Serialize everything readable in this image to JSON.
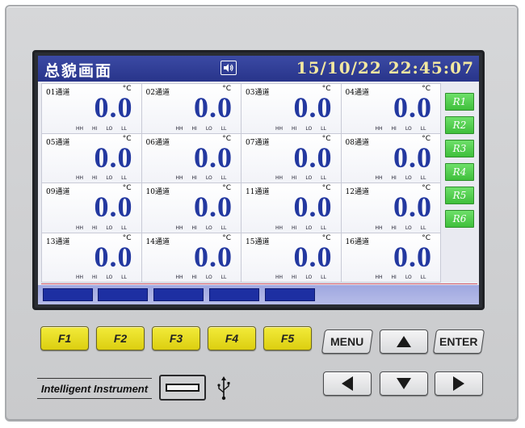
{
  "screen": {
    "title": "总貌画面",
    "datetime": "15/10/22  22:45:07",
    "sound_icon": "speaker-icon"
  },
  "channels": [
    {
      "label": "01通道",
      "unit": "°C",
      "value": "0.0"
    },
    {
      "label": "02通道",
      "unit": "°C",
      "value": "0.0"
    },
    {
      "label": "03通道",
      "unit": "°C",
      "value": "0.0"
    },
    {
      "label": "04通道",
      "unit": "°C",
      "value": "0.0"
    },
    {
      "label": "05通道",
      "unit": "°C",
      "value": "0.0"
    },
    {
      "label": "06通道",
      "unit": "°C",
      "value": "0.0"
    },
    {
      "label": "07通道",
      "unit": "°C",
      "value": "0.0"
    },
    {
      "label": "08通道",
      "unit": "°C",
      "value": "0.0"
    },
    {
      "label": "09通道",
      "unit": "°C",
      "value": "0.0"
    },
    {
      "label": "10通道",
      "unit": "°C",
      "value": "0.0"
    },
    {
      "label": "11通道",
      "unit": "°C",
      "value": "0.0"
    },
    {
      "label": "12通道",
      "unit": "°C",
      "value": "0.0"
    },
    {
      "label": "13通道",
      "unit": "°C",
      "value": "0.0"
    },
    {
      "label": "14通道",
      "unit": "°C",
      "value": "0.0"
    },
    {
      "label": "15通道",
      "unit": "°C",
      "value": "0.0"
    },
    {
      "label": "16通道",
      "unit": "°C",
      "value": "0.0"
    }
  ],
  "alarm_labels": [
    "HH",
    "HI",
    "LO",
    "LL"
  ],
  "relays": [
    "R1",
    "R2",
    "R3",
    "R4",
    "R5",
    "R6"
  ],
  "function_keys": [
    "F1",
    "F2",
    "F3",
    "F4",
    "F5"
  ],
  "control_keys": {
    "menu": "MENU",
    "enter": "ENTER"
  },
  "brand": "Intelligent  Instrument",
  "colors": {
    "value_text": "#2338a0",
    "title_bar": "#28348a",
    "relay_on": "#3fbf3b",
    "function_key": "#dccf10"
  }
}
